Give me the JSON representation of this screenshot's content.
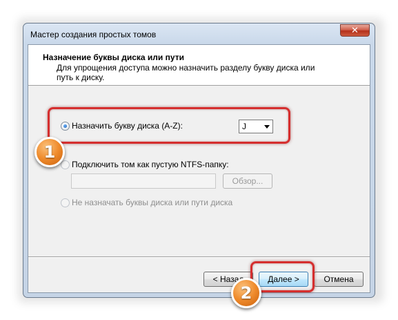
{
  "window": {
    "title": "Мастер создания простых томов",
    "close_symbol": "✕"
  },
  "header": {
    "title": "Назначение буквы диска или пути",
    "description": "Для упрощения доступа можно назначить разделу букву диска или путь к диску."
  },
  "options": {
    "assign_letter": {
      "label": "Назначить букву диска (A-Z):",
      "selected": true
    },
    "drive_letter": {
      "value": "J"
    },
    "mount_folder": {
      "label": "Подключить том как пустую NTFS-папку:",
      "selected": false,
      "path_value": "",
      "browse_label": "Обзор..."
    },
    "no_letter": {
      "label": "Не назначать буквы диска или пути диска",
      "selected": false
    }
  },
  "footer": {
    "back_label": "< Назад",
    "next_label": "Далее >",
    "cancel_label": "Отмена"
  },
  "annotations": {
    "step1": "1",
    "step2": "2",
    "highlight_color": "#d52e2e",
    "badge_color": "#ef8b2c"
  }
}
